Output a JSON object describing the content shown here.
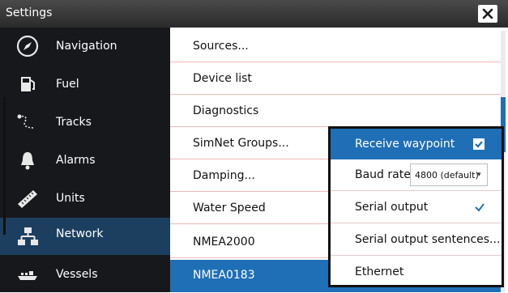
{
  "title": "Settings",
  "close_icon": "close-icon",
  "colors": {
    "title_bar": "#3a3a3a",
    "sidebar_bg": "#16181b",
    "sidebar_active": "#1c3f60",
    "highlight_blue": "#1f6fb6"
  },
  "sidebar": {
    "items": [
      {
        "label": "Navigation",
        "icon": "compass-icon"
      },
      {
        "label": "Fuel",
        "icon": "fuel-pump-icon"
      },
      {
        "label": "Tracks",
        "icon": "track-icon"
      },
      {
        "label": "Alarms",
        "icon": "bell-icon"
      },
      {
        "label": "Units",
        "icon": "ruler-icon"
      },
      {
        "label": "Network",
        "icon": "network-icon",
        "selected": true
      },
      {
        "label": "Vessels",
        "icon": "vessels-icon"
      }
    ]
  },
  "network_list": {
    "items": [
      {
        "label": "Sources..."
      },
      {
        "label": "Device list"
      },
      {
        "label": "Diagnostics"
      },
      {
        "label": "SimNet Groups..."
      },
      {
        "label": "Damping..."
      },
      {
        "label": "Water Speed"
      },
      {
        "label": "NMEA2000"
      },
      {
        "label": "NMEA0183",
        "selected": true
      }
    ]
  },
  "nmea_popup": {
    "receive_waypoint_label": "Receive waypoint",
    "receive_waypoint_checked": true,
    "baud_rate_label": "Baud rate",
    "baud_rate_value": "4800 (default)",
    "serial_output_label": "Serial output",
    "serial_output_checked": true,
    "serial_output_sentences_label": "Serial output sentences...",
    "ethernet_label": "Ethernet"
  }
}
